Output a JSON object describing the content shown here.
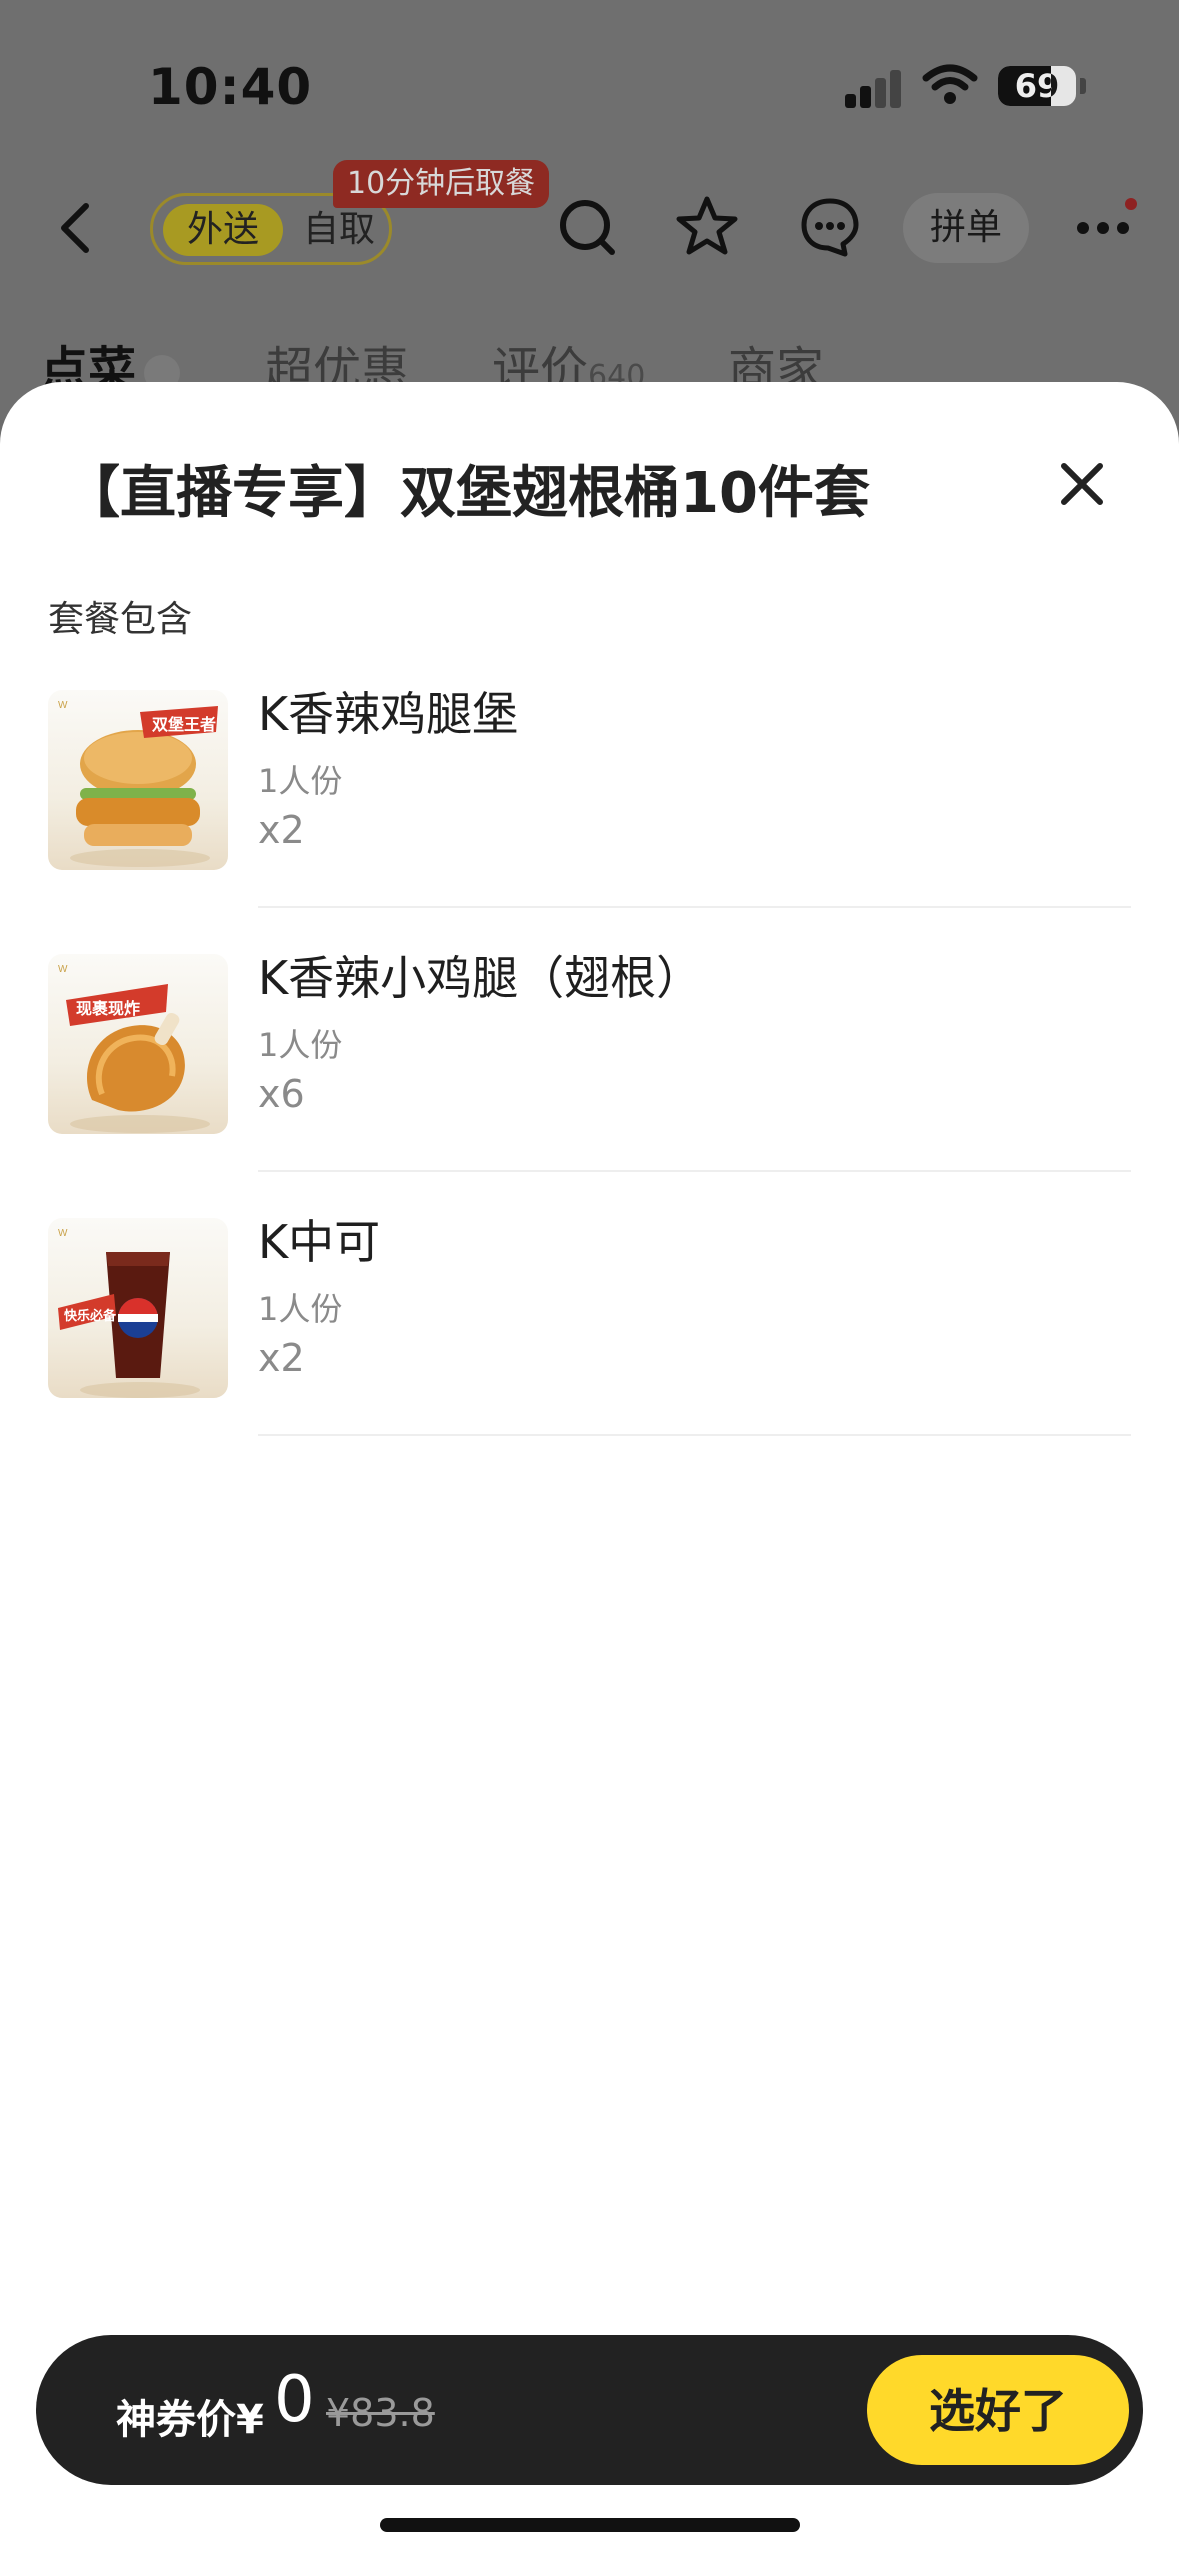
{
  "status_bar": {
    "time": "10:40",
    "battery": "69"
  },
  "nav": {
    "delivery_label": "外送",
    "pickup_label": "自取",
    "promo_badge": "10分钟后取餐",
    "pindan_label": "拼单"
  },
  "tabs": [
    {
      "label": "点菜"
    },
    {
      "label": "超优惠"
    },
    {
      "label": "评价",
      "count": "640"
    },
    {
      "label": "商家"
    }
  ],
  "sheet": {
    "title": "【直播专享】双堡翅根桶10件套",
    "section_label": "套餐包含",
    "items": [
      {
        "name": "K香辣鸡腿堡",
        "portion": "1人份",
        "qty": "x2",
        "badge": "双堡王者"
      },
      {
        "name": "K香辣小鸡腿（翅根）",
        "portion": "1人份",
        "qty": "x6",
        "badge": "现裹现炸"
      },
      {
        "name": "K中可",
        "portion": "1人份",
        "qty": "x2",
        "badge": "快乐必备"
      }
    ]
  },
  "bottom_bar": {
    "price_label": "神券价¥",
    "price_value": "0",
    "original_price": "¥83.8",
    "confirm_label": "选好了"
  },
  "colors": {
    "accent_yellow": "#ffd92a",
    "bar_dark": "#222222",
    "promo_red": "#8e2a22"
  }
}
